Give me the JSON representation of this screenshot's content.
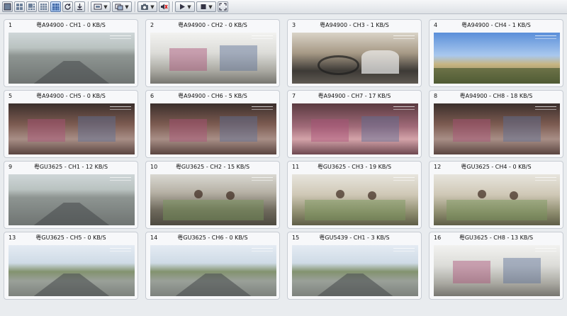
{
  "toolbar": {
    "buttons": [
      {
        "name": "layout-1x1-icon"
      },
      {
        "name": "layout-2x2-icon"
      },
      {
        "name": "layout-1plus5-icon"
      },
      {
        "name": "layout-3x3-icon"
      },
      {
        "name": "layout-4x4-icon",
        "active": true
      },
      {
        "name": "refresh-icon"
      },
      {
        "name": "download-icon"
      },
      {
        "name": "display-dropdown-icon"
      },
      {
        "name": "stream-dropdown-icon"
      },
      {
        "name": "snapshot-dropdown-icon"
      },
      {
        "name": "audio-muted-icon"
      },
      {
        "name": "play-dropdown-icon"
      },
      {
        "name": "stop-dropdown-icon"
      },
      {
        "name": "fullscreen-icon"
      }
    ]
  },
  "tiles": [
    {
      "num": "1",
      "title": "粤A94900 - CH1 - 0 KB/S",
      "scene": "s-road"
    },
    {
      "num": "2",
      "title": "粤A94900 - CH2 - 0 KB/S",
      "scene": "s-white"
    },
    {
      "num": "3",
      "title": "粤A94900 - CH3 - 1 KB/S",
      "scene": "s-driver"
    },
    {
      "num": "4",
      "title": "粤A94900 - CH4 - 1 KB/S",
      "scene": "s-sky"
    },
    {
      "num": "5",
      "title": "粤A94900 - CH5 - 0 KB/S",
      "scene": "s-cabin"
    },
    {
      "num": "6",
      "title": "粤A94900 - CH6 - 5 KB/S",
      "scene": "s-cabin"
    },
    {
      "num": "7",
      "title": "粤A94900 - CH7 - 17 KB/S",
      "scene": "s-pink"
    },
    {
      "num": "8",
      "title": "粤A94900 - CH8 - 18 KB/S",
      "scene": "s-cabin"
    },
    {
      "num": "9",
      "title": "粤GU3625 - CH1 - 12 KB/S",
      "scene": "s-road"
    },
    {
      "num": "10",
      "title": "粤GU3625 - CH2 - 15 KB/S",
      "scene": "s-bus"
    },
    {
      "num": "11",
      "title": "粤GU3625 - CH3 - 19 KB/S",
      "scene": "s-bus2"
    },
    {
      "num": "12",
      "title": "粤GU3625 - CH4 - 0 KB/S",
      "scene": "s-bus2"
    },
    {
      "num": "13",
      "title": "粤GU3625 - CH5 - 0 KB/S",
      "scene": "s-highway"
    },
    {
      "num": "14",
      "title": "粤GU3625 - CH6 - 0 KB/S",
      "scene": "s-highway"
    },
    {
      "num": "15",
      "title": "粤GU5439 - CH1 - 3 KB/S",
      "scene": "s-highway"
    },
    {
      "num": "16",
      "title": "粤GU3625 - CH8 - 13 KB/S",
      "scene": "s-white"
    }
  ]
}
